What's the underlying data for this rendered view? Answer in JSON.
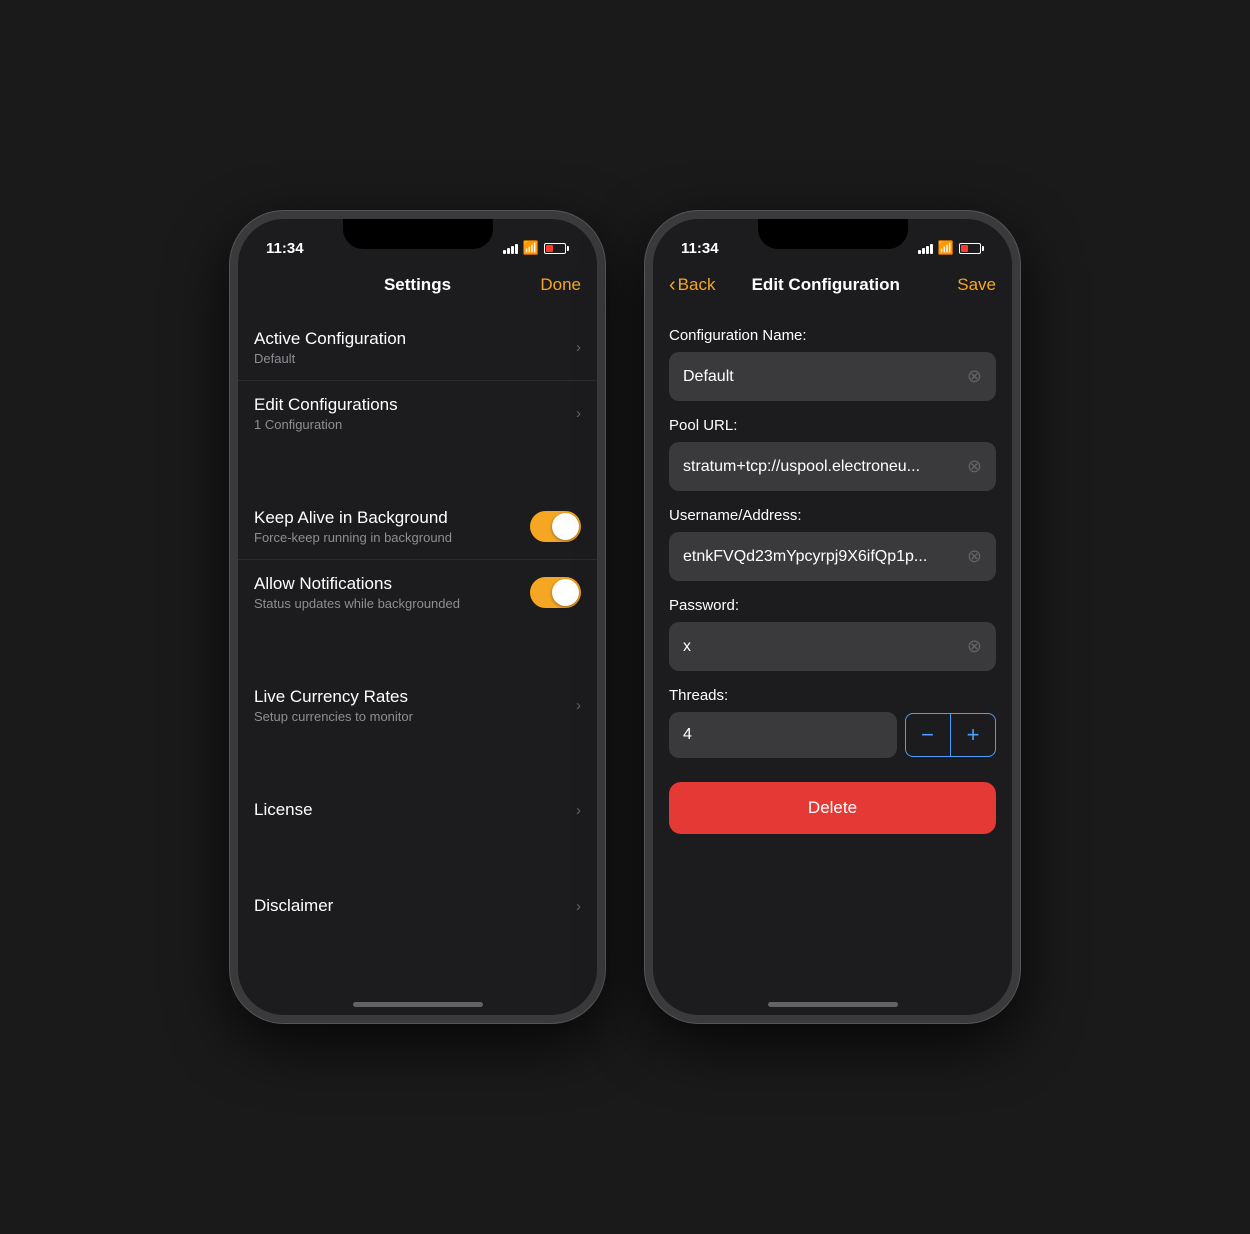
{
  "phone1": {
    "status": {
      "time": "11:34",
      "signal": [
        4,
        6,
        8,
        10,
        12
      ],
      "battery_color": "#ff3b30"
    },
    "nav": {
      "title": "Settings",
      "right_btn": "Done"
    },
    "sections": [
      {
        "items": [
          {
            "title": "Active Configuration",
            "subtitle": "Default",
            "type": "nav"
          },
          {
            "title": "Edit Configurations",
            "subtitle": "1 Configuration",
            "type": "nav"
          }
        ]
      },
      {
        "items": [
          {
            "title": "Keep Alive in Background",
            "subtitle": "Force-keep running in background",
            "type": "toggle",
            "value": true
          },
          {
            "title": "Allow Notifications",
            "subtitle": "Status updates while backgrounded",
            "type": "toggle",
            "value": true
          }
        ]
      },
      {
        "items": [
          {
            "title": "Live Currency Rates",
            "subtitle": "Setup currencies to monitor",
            "type": "nav"
          }
        ]
      },
      {
        "items": [
          {
            "title": "License",
            "subtitle": "",
            "type": "nav"
          }
        ]
      },
      {
        "items": [
          {
            "title": "Disclaimer",
            "subtitle": "",
            "type": "nav"
          }
        ]
      }
    ]
  },
  "phone2": {
    "status": {
      "time": "11:34"
    },
    "nav": {
      "back_label": "Back",
      "title": "Edit Configuration",
      "right_btn": "Save"
    },
    "form": {
      "config_name_label": "Configuration Name:",
      "config_name_value": "Default",
      "pool_url_label": "Pool URL:",
      "pool_url_value": "stratum+tcp://uspool.electroneu...",
      "username_label": "Username/Address:",
      "username_value": "etnkFVQd23mYpcyrpj9X6ifQp1p...",
      "password_label": "Password:",
      "password_value": "x",
      "threads_label": "Threads:",
      "threads_value": "4",
      "delete_btn": "Delete",
      "decrement_icon": "−",
      "increment_icon": "+"
    }
  }
}
